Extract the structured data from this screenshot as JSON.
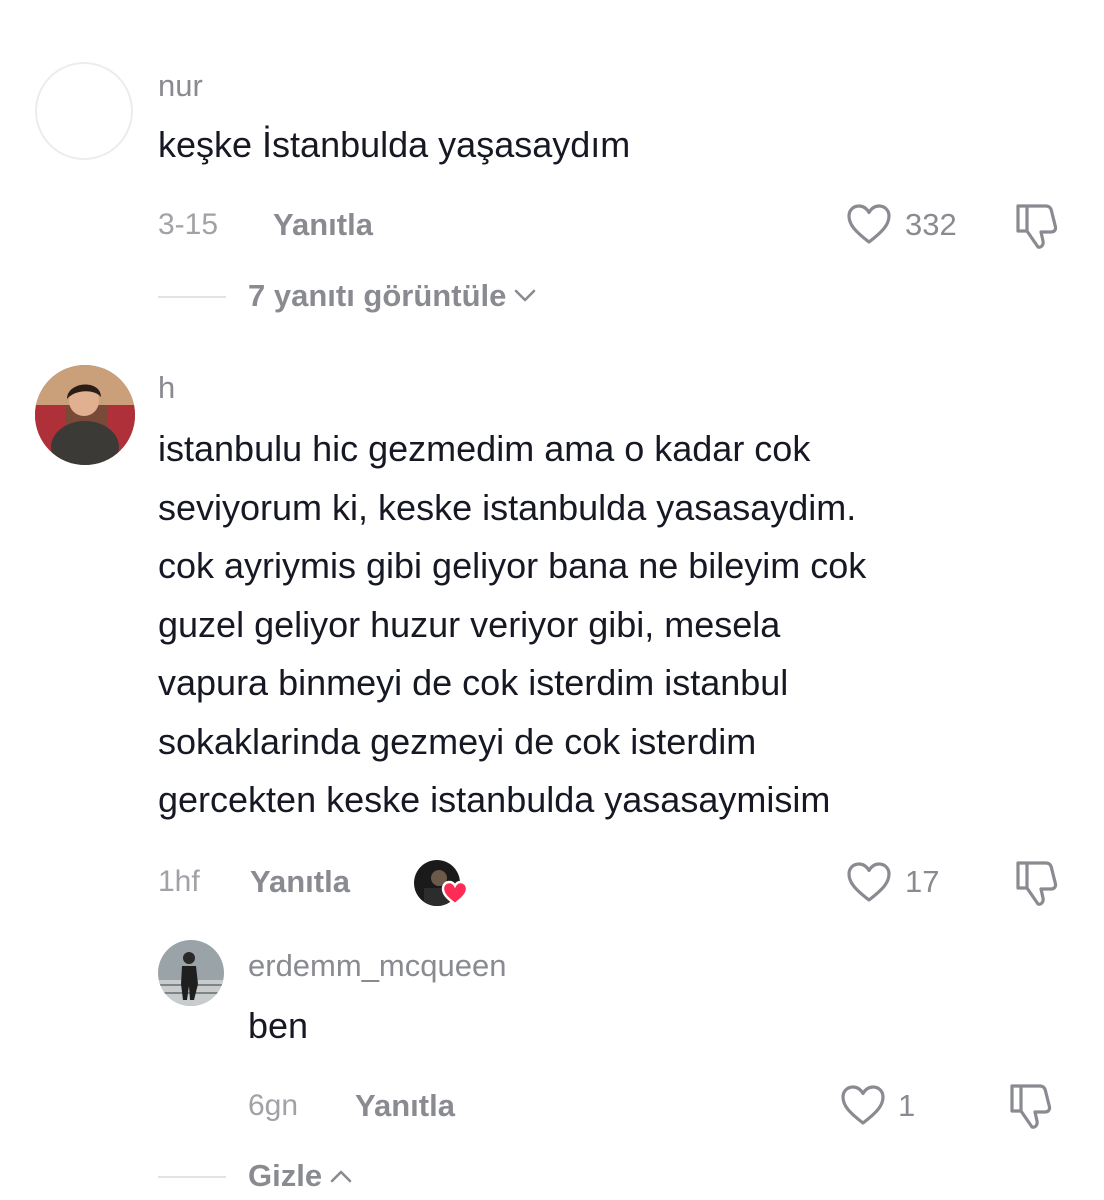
{
  "comments": [
    {
      "username": "nur",
      "text": "keşke İstanbulda yaşasaydım",
      "date": "3-15",
      "reply_label": "Yanıtla",
      "likes": "332",
      "thread_toggle": "7 yanıtı görüntüle"
    },
    {
      "username": "h",
      "text_lines": [
        "istanbulu hic gezmedim ama o kadar cok",
        "seviyorum ki, keske istanbulda yasasaydim.",
        "cok ayriymis gibi geliyor bana ne bileyim cok",
        "guzel geliyor huzur veriyor gibi, mesela",
        "vapura binmeyi de cok isterdim istanbul",
        "sokaklarinda gezmeyi de cok isterdim",
        "gercekten keske istanbulda yasasaymisim"
      ],
      "date": "1hf",
      "reply_label": "Yanıtla",
      "likes": "17",
      "replies": [
        {
          "username": "erdemm_mcqueen",
          "text": "ben",
          "date": "6gn",
          "reply_label": "Yanıtla",
          "likes": "1"
        }
      ],
      "thread_toggle": "Gizle"
    }
  ],
  "colors": {
    "liked_heart": "#fe2c55",
    "muted_text": "#8a8b91"
  }
}
